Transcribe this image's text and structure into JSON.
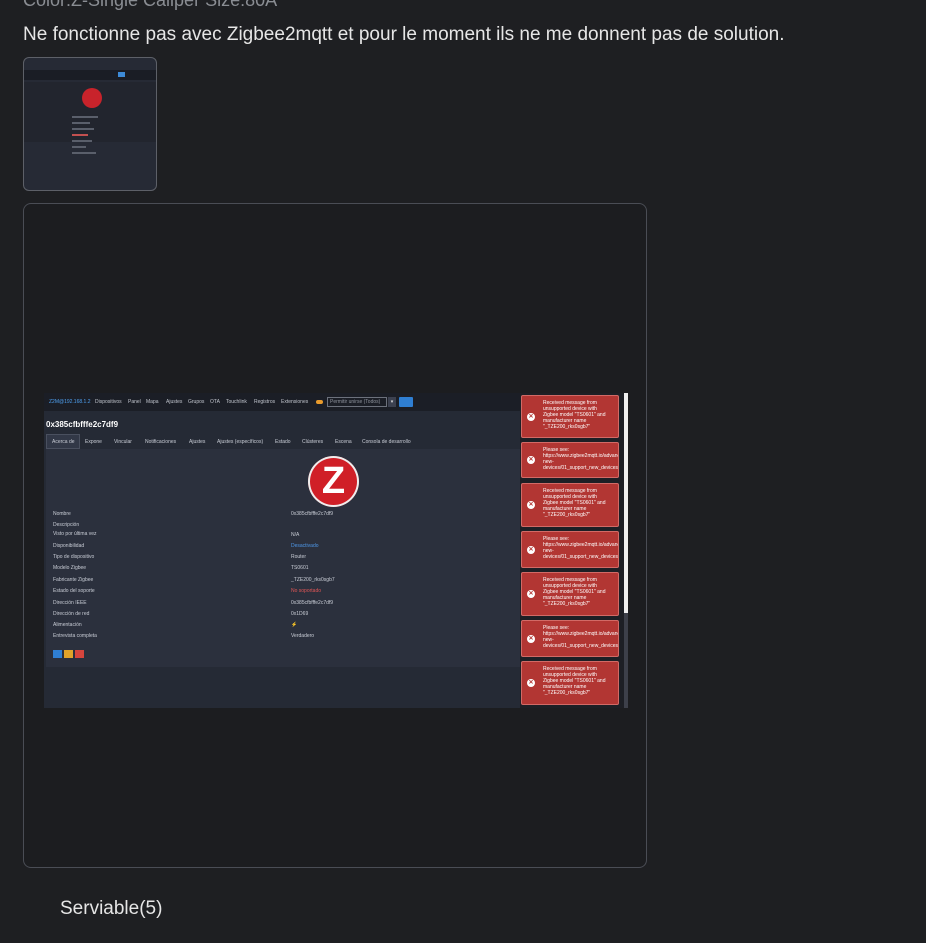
{
  "review": {
    "variant": "Color:Z-Single Caliper Size:80A",
    "text": "Ne fonctionne pas avec Zigbee2mqtt et pour le moment ils ne me donnent pas de solution.",
    "helpful_label": "Serviable(5)"
  },
  "screenshot": {
    "nav": {
      "brand": "Z2M@192.168.1.2",
      "items": [
        "Dispositivos",
        "Panel",
        "Mapa",
        "Ajustes",
        "Grupos",
        "OTA",
        "Touchlink",
        "Registros",
        "Extensiones"
      ],
      "permit_join": "Permitir unirse (Todos)",
      "dropdown": "▾"
    },
    "device_title": "0x385cfbfffe2c7df9",
    "tabs": [
      "Acerca de",
      "Expone",
      "Vincular",
      "Notificaciones",
      "Ajustes",
      "Ajustes (específicos)",
      "Estado",
      "Clústeres",
      "Escena",
      "Consola de desarrollo"
    ],
    "details": [
      {
        "label": "Nombre",
        "value": "0x385cfbfffe2c7df9"
      },
      {
        "label": "Descripción",
        "value": ""
      },
      {
        "label": "Visto por última vez",
        "value": "N/A"
      },
      {
        "label": "Disponibilidad",
        "value": "Desactivado"
      },
      {
        "label": "Tipo de dispositivo",
        "value": "Router"
      },
      {
        "label": "Modelo Zigbee",
        "value": "TS0601"
      },
      {
        "label": "Fabricante Zigbee",
        "value": "_TZE200_rks0sgb7"
      },
      {
        "label": "Estado del soporte",
        "value": "No soportado"
      },
      {
        "label": "Dirección IEEE",
        "value": "0x385cfbfffe2c7df9"
      },
      {
        "label": "Dirección de red",
        "value": "0x1D69"
      },
      {
        "label": "Alimentación",
        "value": "⚡"
      },
      {
        "label": "Entrevista completa",
        "value": "Verdadero"
      }
    ],
    "logo_letter": "Z",
    "toasts": [
      {
        "icon": "✕",
        "text": "Received message from\nunsupported device with\nZigbee model \"TS0601\" and\nmanufacturer name\n\"_TZE200_rks0sgb7\""
      },
      {
        "icon": "✕",
        "text": "Please see:\nhttps://www.zigbee2mqtt.io/advanced/support-\nnew-\ndevices/01_support_new_devices.html"
      },
      {
        "icon": "✕",
        "text": "Received message from\nunsupported device with\nZigbee model \"TS0601\" and\nmanufacturer name\n\"_TZE200_rks0sgb7\""
      },
      {
        "icon": "✕",
        "text": "Please see:\nhttps://www.zigbee2mqtt.io/advanced/support-\nnew-\ndevices/01_support_new_devices.html"
      },
      {
        "icon": "✕",
        "text": "Received message from\nunsupported device with\nZigbee model \"TS0601\" and\nmanufacturer name\n\"_TZE200_rks0sgb7\""
      },
      {
        "icon": "✕",
        "text": "Please see:\nhttps://www.zigbee2mqtt.io/advanced/support-\nnew-\ndevices/01_support_new_devices.html"
      },
      {
        "icon": "✕",
        "text": "Received message from\nunsupported device with\nZigbee model \"TS0601\" and\nmanufacturer name\n\"_TZE200_rks0sgb7\""
      }
    ],
    "action_icons": [
      "edit-icon",
      "swap-icon",
      "delete-icon"
    ],
    "colors": {
      "toast_bg": "#b23633",
      "logo_red": "#d01f27",
      "link_blue": "#4e97e8",
      "status_red": "#e25656"
    }
  }
}
